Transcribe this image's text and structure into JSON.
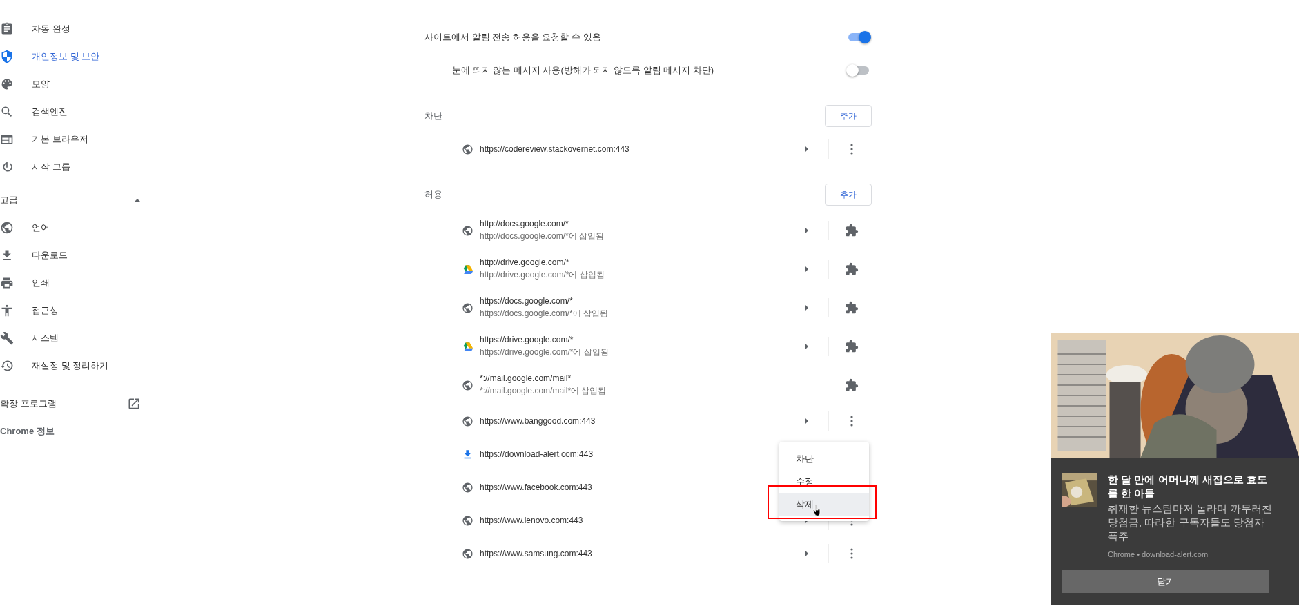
{
  "sidebar": {
    "items": [
      {
        "label": "자동 완성",
        "selected": false
      },
      {
        "label": "개인정보 및 보안",
        "selected": true
      },
      {
        "label": "모양",
        "selected": false
      },
      {
        "label": "검색엔진",
        "selected": false
      },
      {
        "label": "기본 브라우저",
        "selected": false
      },
      {
        "label": "시작 그룹",
        "selected": false
      }
    ],
    "advanced": {
      "label": "고급",
      "expanded": true
    },
    "advanced_items": [
      {
        "label": "언어",
        "selected": false
      },
      {
        "label": "다운로드",
        "selected": false
      },
      {
        "label": "인쇄",
        "selected": false
      },
      {
        "label": "접근성",
        "selected": false
      },
      {
        "label": "시스템",
        "selected": false
      },
      {
        "label": "재설정 및 정리하기",
        "selected": false
      }
    ],
    "extensions": "확장 프로그램",
    "about": "Chrome 정보"
  },
  "settings": [
    {
      "label": "사이트에서 알림 전송 허용을 요청할 수 있음",
      "on": true,
      "indented": false
    },
    {
      "label": "눈에 띄지 않는 메시지 사용(방해가 되지 않도록 알림 메시지 차단)",
      "on": false,
      "indented": true
    }
  ],
  "blocked": {
    "title": "차단",
    "add_button": "추가",
    "rows": [
      {
        "kind": "site",
        "url": "https://codereview.stackovernet.com:443",
        "has_arrow": true
      }
    ]
  },
  "allowed": {
    "title": "허용",
    "add_button": "추가",
    "rows": [
      {
        "kind": "extension",
        "url": "http://docs.google.com/*",
        "note": "http://docs.google.com/*에 삽입됨",
        "has_arrow": true
      },
      {
        "kind": "extension",
        "url": "http://drive.google.com/*",
        "note": "http://drive.google.com/*에 삽입됨",
        "has_arrow": true
      },
      {
        "kind": "extension",
        "url": "https://docs.google.com/*",
        "note": "https://docs.google.com/*에 삽입됨",
        "has_arrow": true
      },
      {
        "kind": "extension",
        "url": "https://drive.google.com/*",
        "note": "https://drive.google.com/*에 삽입됨",
        "has_arrow": true
      },
      {
        "kind": "extension",
        "url": "*://mail.google.com/mail*",
        "note": "*://mail.google.com/mail*에 삽입됨",
        "has_arrow": false
      },
      {
        "kind": "site",
        "url": "https://www.banggood.com:443",
        "has_arrow": true
      },
      {
        "kind": "site",
        "url": "https://download-alert.com:443"
      },
      {
        "kind": "site",
        "url": "https://www.facebook.com:443"
      },
      {
        "kind": "site",
        "url": "https://www.lenovo.com:443",
        "has_arrow": true
      },
      {
        "kind": "site",
        "url": "https://www.samsung.com:443",
        "has_arrow": true
      }
    ]
  },
  "menu": {
    "items": [
      {
        "label": "차단",
        "selected": false
      },
      {
        "label": "수정",
        "selected": false
      },
      {
        "label": "삭제",
        "selected": true
      }
    ]
  },
  "notification": {
    "title": "한 달 만에 어머니께 새집으로 효도를 한 아들",
    "body": "취재한 뉴스팀마저 놀라며 까무러친 당첨금, 따라한 구독자들도 당첨자 폭주",
    "source": "Chrome • download-alert.com",
    "close_button": "닫기"
  }
}
